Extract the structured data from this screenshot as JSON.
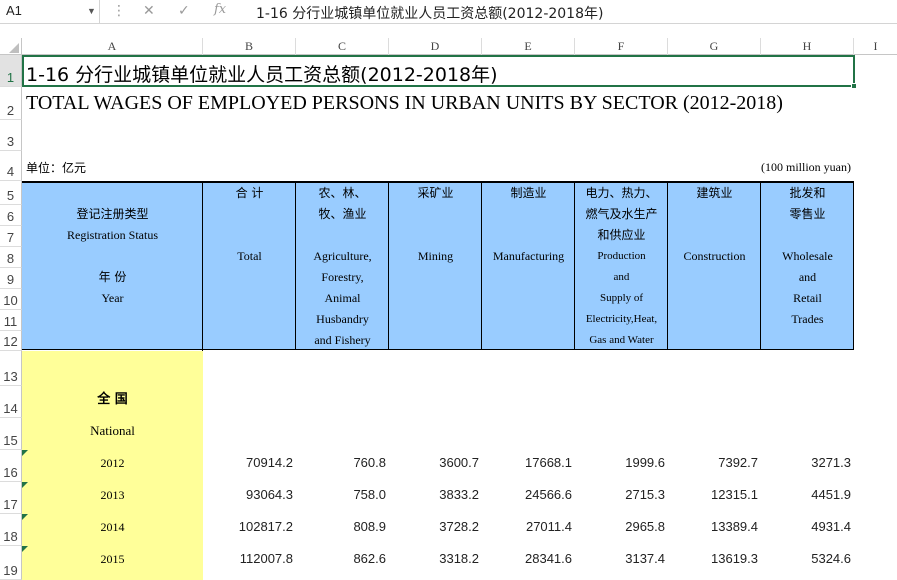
{
  "formula_bar": {
    "name_box": "A1",
    "formula": "1-16  分行业城镇单位就业人员工资总额(2012-2018年)"
  },
  "columns": [
    "A",
    "B",
    "C",
    "D",
    "E",
    "F",
    "G",
    "H",
    "I"
  ],
  "rows": [
    "1",
    "2",
    "3",
    "4",
    "5",
    "6",
    "7",
    "8",
    "9",
    "10",
    "11",
    "12",
    "13",
    "14",
    "15",
    "16",
    "17",
    "18",
    "19"
  ],
  "sheet": {
    "title_cn": "1-16  分行业城镇单位就业人员工资总额(2012-2018年)",
    "title_en": "TOTAL WAGES OF EMPLOYED PERSONS IN URBAN UNITS BY SECTOR (2012-2018)",
    "unit_cn": "单位：亿元",
    "unit_en": "(100 million yuan)",
    "stub_header": [
      "登记注册类型",
      "Registration Status",
      "",
      "年  份",
      "Year"
    ],
    "headers": [
      {
        "cn": [
          "合  计"
        ],
        "en": [
          "Total"
        ]
      },
      {
        "cn": [
          "农、林、",
          "牧、渔业"
        ],
        "en": [
          "Agriculture,",
          "Forestry,",
          "Animal",
          "Husbandry",
          "and Fishery"
        ]
      },
      {
        "cn": [
          "采矿业"
        ],
        "en": [
          "Mining"
        ]
      },
      {
        "cn": [
          "制造业"
        ],
        "en": [
          "Manufacturing"
        ]
      },
      {
        "cn": [
          "电力、热力、",
          "燃气及水生产",
          "和供应业"
        ],
        "en": [
          "Production",
          "and",
          "Supply of",
          "Electricity,Heat,",
          "Gas and Water"
        ]
      },
      {
        "cn": [
          "建筑业"
        ],
        "en": [
          "Construction"
        ]
      },
      {
        "cn": [
          "批发和",
          "零售业"
        ],
        "en": [
          "Wholesale",
          "and",
          "Retail",
          "Trades"
        ]
      }
    ],
    "national_cn": "全  国",
    "national_en": "National",
    "data": [
      {
        "year": "2012",
        "values": [
          "70914.2",
          "760.8",
          "3600.7",
          "17668.1",
          "1999.6",
          "7392.7",
          "3271.3"
        ]
      },
      {
        "year": "2013",
        "values": [
          "93064.3",
          "758.0",
          "3833.2",
          "24566.6",
          "2715.3",
          "12315.1",
          "4451.9"
        ]
      },
      {
        "year": "2014",
        "values": [
          "102817.2",
          "808.9",
          "3728.2",
          "27011.4",
          "2965.8",
          "13389.4",
          "4931.4"
        ]
      },
      {
        "year": "2015",
        "values": [
          "112007.8",
          "862.6",
          "3318.2",
          "28341.6",
          "3137.4",
          "13619.3",
          "5324.6"
        ]
      }
    ]
  }
}
